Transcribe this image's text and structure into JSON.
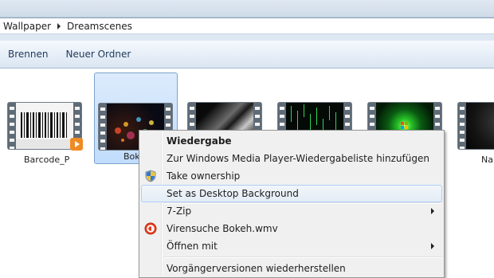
{
  "address": {
    "crumbs": [
      "Wallpaper",
      "Dreamscenes"
    ]
  },
  "toolbar": {
    "burn_label": "Brennen",
    "new_folder_label": "Neuer Ordner"
  },
  "files": [
    {
      "name": "Barcode_P",
      "selected": false
    },
    {
      "name": "Bokeh.wmv",
      "label_visible": "Bok",
      "selected": true
    },
    {
      "name": "",
      "selected": false
    },
    {
      "name": "",
      "selected": false
    },
    {
      "name": "",
      "selected": false
    },
    {
      "name": "",
      "label_visible": "Na",
      "selected": false
    }
  ],
  "context_menu": {
    "items": [
      {
        "label": "Wiedergabe",
        "default": true
      },
      {
        "label": "Zur Windows Media Player-Wiedergabeliste hinzufügen"
      },
      {
        "label": "Take ownership",
        "icon": "uac-shield-icon"
      },
      {
        "label": "Set as Desktop Background",
        "hovered": true
      },
      {
        "label": "7-Zip",
        "submenu": true
      },
      {
        "label": "Virensuche Bokeh.wmv",
        "icon": "avira-umbrella-icon"
      },
      {
        "label": "Öffnen mit",
        "submenu": true
      },
      {
        "label": "Vorgängerversionen wiederherstellen"
      }
    ]
  },
  "colors": {
    "selection_fill": "#c9e0fc",
    "selection_border": "#7da2ce",
    "menu_bg": "#f0f0f0",
    "menu_hover_border": "#aecff7",
    "toolbar_text": "#1e395b"
  }
}
